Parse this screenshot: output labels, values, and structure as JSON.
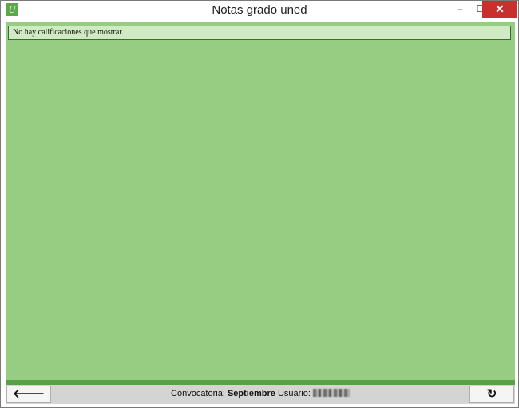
{
  "window": {
    "title": "Notas grado uned",
    "app_icon_letter": "U",
    "app_icon_name": "uned-app-icon",
    "controls": {
      "minimize": "–",
      "maximize": "☐",
      "close": "✕"
    }
  },
  "main": {
    "message": "No hay calificaciones que mostrar."
  },
  "statusbar": {
    "back_glyph": "🡐",
    "refresh_glyph": "↻",
    "convocatoria_label": "Convocatoria:",
    "convocatoria_value": "Septiembre",
    "usuario_label": "Usuario:"
  },
  "colors": {
    "content_bg": "#97cd83",
    "accent_strip": "#59a149",
    "close_button": "#c7302c"
  }
}
